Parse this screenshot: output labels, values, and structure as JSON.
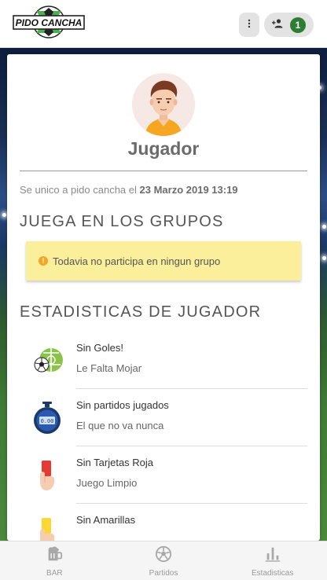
{
  "header": {
    "logo_text": "PIDO CANCHA",
    "more_icon": "more-vert-icon",
    "friends_icon": "person-add-icon",
    "friends_count": "1"
  },
  "profile": {
    "name": "Jugador",
    "joined_prefix": "Se unico a pido cancha el",
    "joined_date": "23 Marzo 2019 13:19"
  },
  "groups": {
    "title": "JUEGA EN LOS GRUPOS",
    "alert_text": "Todavia no participa en ningun grupo",
    "alert_color": "#fbef9b"
  },
  "stats": {
    "title": "ESTADISTICAS DE JUGADOR",
    "items": [
      {
        "title": "Sin Goles!",
        "subtitle": "Le Falta Mojar",
        "icon": "soccer-ball-icon"
      },
      {
        "title": "Sin partidos jugados",
        "subtitle": "El que no va nunca",
        "icon": "stopwatch-icon"
      },
      {
        "title": "Sin Tarjetas Roja",
        "subtitle": "Juego Limpio",
        "icon": "red-card-icon"
      },
      {
        "title": "Sin Amarillas",
        "subtitle": "",
        "icon": "yellow-card-icon"
      }
    ]
  },
  "bottom_nav": [
    {
      "label": "BAR",
      "icon": "beer-mug-icon"
    },
    {
      "label": "Partidos",
      "icon": "soccer-ball-icon"
    },
    {
      "label": "Estadisticas",
      "icon": "bar-chart-icon"
    }
  ],
  "colors": {
    "accent": "#2e7d32",
    "muted_text": "#8a8a8a"
  }
}
